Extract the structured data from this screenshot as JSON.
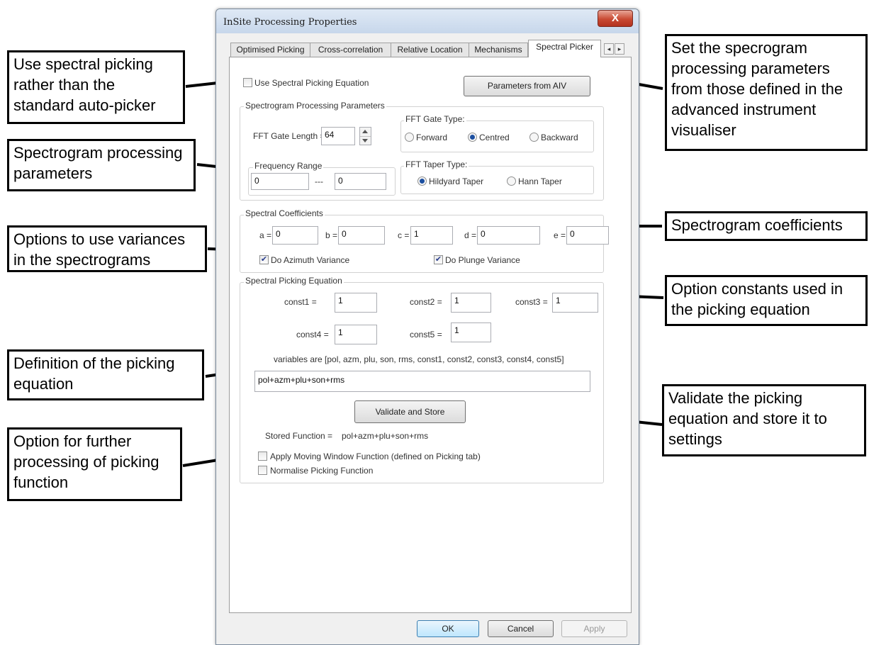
{
  "window": {
    "title": "InSite Processing Properties",
    "close_glyph": "X"
  },
  "tabs": [
    "Optimised Picking",
    "Cross-correlation",
    "Relative Location",
    "Mechanisms",
    "Spectral Picker"
  ],
  "tab_scroll": {
    "left_glyph": "◂",
    "right_glyph": "▸"
  },
  "top": {
    "use_spectral_label": "Use Spectral Picking Equation",
    "use_spectral_checked": false,
    "params_button": "Parameters from AIV"
  },
  "spectrogram": {
    "legend": "Spectrogram Processing Parameters",
    "fft_gate_length_label": "FFT Gate Length =",
    "fft_gate_length_value": "64",
    "gate_type_legend": "FFT Gate Type:",
    "gate_types": [
      "Forward",
      "Centred",
      "Backward"
    ],
    "gate_type_selected": "Centred",
    "freq_legend": "Frequency Range",
    "freq_min": "0",
    "freq_sep": "---",
    "freq_max": "0",
    "taper_legend": "FFT Taper Type:",
    "tapers": [
      "Hildyard Taper",
      "Hann Taper"
    ],
    "taper_selected": "Hildyard Taper"
  },
  "coefficients": {
    "legend": "Spectral Coefficients",
    "items": [
      {
        "label": "a =",
        "value": "0"
      },
      {
        "label": "b =",
        "value": "0"
      },
      {
        "label": "c =",
        "value": "1"
      },
      {
        "label": "d =",
        "value": "0"
      },
      {
        "label": "e =",
        "value": "0"
      }
    ],
    "azimuth_label": "Do Azimuth Variance",
    "azimuth_checked": true,
    "plunge_label": "Do Plunge Variance",
    "plunge_checked": true
  },
  "equation": {
    "legend": "Spectral Picking Equation",
    "consts": [
      {
        "label": "const1 =",
        "value": "1"
      },
      {
        "label": "const2 =",
        "value": "1"
      },
      {
        "label": "const3 =",
        "value": "1"
      },
      {
        "label": "const4 =",
        "value": "1"
      },
      {
        "label": "const5 =",
        "value": "1"
      }
    ],
    "variables_text": "variables are [pol, azm, plu, son, rms, const1, const2, const3, const4, const5]",
    "equation_value": "pol+azm+plu+son+rms",
    "validate_button": "Validate and Store",
    "stored_label": "Stored Function =",
    "stored_value": "pol+azm+plu+son+rms",
    "moving_window_label": "Apply Moving Window Function (defined on Picking tab)",
    "moving_window_checked": false,
    "normalise_label": "Normalise Picking Function",
    "normalise_checked": false
  },
  "footer": {
    "ok": "OK",
    "cancel": "Cancel",
    "apply": "Apply"
  },
  "annotations": {
    "use_spectral": "Use spectral picking rather than the standard auto-picker",
    "spectrogram_params": "Spectrogram processing parameters",
    "variances": "Options to use variances in the spectrograms",
    "definition": "Definition of the picking equation",
    "further": "Option for further processing of picking function",
    "aiv": "Set the specrogram processing parameters from those defined in the advanced instrument visualiser",
    "coefficients": "Spectrogram coefficients",
    "constants": "Option constants used in the picking equation",
    "validate": "Validate the picking equation and store it to settings"
  },
  "colors": {
    "radio_dot": "#1c4fa0",
    "check_mark": "#2a3e8e",
    "close_button": "#c94a33"
  }
}
